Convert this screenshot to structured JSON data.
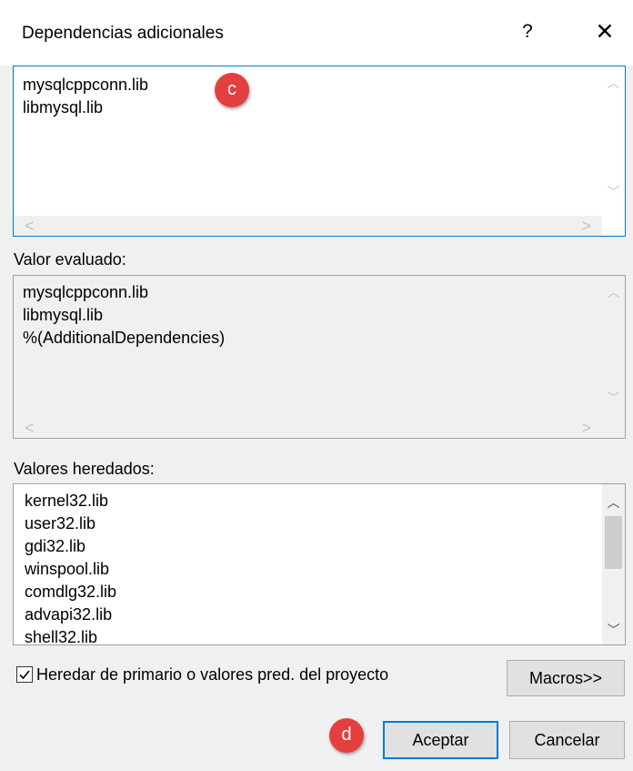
{
  "dialog": {
    "title": "Dependencias adicionales",
    "help_label": "?",
    "close_label": "✕"
  },
  "editor": {
    "lines": [
      "mysqlcppconn.lib",
      "libmysql.lib"
    ]
  },
  "evaluated": {
    "label": "Valor evaluado:",
    "lines": [
      "mysqlcppconn.lib",
      "libmysql.lib",
      "%(AdditionalDependencies)"
    ]
  },
  "inherited": {
    "label": "Valores heredados:",
    "lines": [
      "kernel32.lib",
      "user32.lib",
      "gdi32.lib",
      "winspool.lib",
      "comdlg32.lib",
      "advapi32.lib",
      "shell32.lib"
    ]
  },
  "inherit_checkbox": {
    "label": "Heredar de primario o valores pred. del proyecto",
    "checked": true
  },
  "buttons": {
    "macros": "Macros>>",
    "accept": "Aceptar",
    "cancel": "Cancelar"
  },
  "markers": {
    "c": "c",
    "d": "d"
  },
  "icons": {
    "scroll_up": "chevron-up-icon",
    "scroll_down": "chevron-down-icon",
    "scroll_left": "chevron-left-icon",
    "scroll_right": "chevron-right-icon",
    "check": "check-icon"
  },
  "colors": {
    "accent": "#0078d7",
    "marker": "#e53e3e",
    "dialog_bg": "#f0f0f0"
  }
}
